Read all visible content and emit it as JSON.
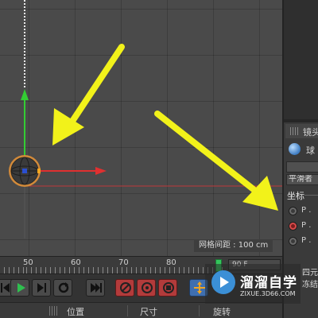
{
  "viewport": {
    "grid_spacing_text": "网格间距 : 100 cm"
  },
  "attribute_panel": {
    "tab_label": "镜头",
    "object_label": "球",
    "field_1": "",
    "field_2": "平滑者",
    "coord_header": "坐标",
    "radios": [
      {
        "label": "P .",
        "selected": false
      },
      {
        "label": "P .",
        "selected": true
      },
      {
        "label": "P .",
        "selected": false
      }
    ],
    "bottom_row_1": "四元",
    "bottom_row_2": "冻结"
  },
  "timeline": {
    "tick_labels": [
      "50",
      "60",
      "70",
      "80"
    ],
    "frame_field": "90 F"
  },
  "transport": {
    "buttons": [
      {
        "name": "go-to-previous-key-button",
        "icon": "prev-key-icon"
      },
      {
        "name": "play-forward-button",
        "icon": "play-icon"
      },
      {
        "name": "next-frame-button",
        "icon": "next-frame-icon"
      },
      {
        "name": "loop-button",
        "icon": "loop-icon"
      },
      {
        "name": "go-to-end-button",
        "icon": "go-to-end-icon"
      },
      {
        "name": "record-position-button",
        "icon": "record-icon"
      },
      {
        "name": "record-rotation-button",
        "icon": "record-rotation-icon"
      },
      {
        "name": "record-scale-button",
        "icon": "record-scale-icon"
      },
      {
        "name": "move-tool-button",
        "icon": "move-icon"
      }
    ]
  },
  "bottom_tabs": {
    "position": "位置",
    "size": "尺寸",
    "rotation": "旋转"
  },
  "watermark": {
    "title": "溜溜自学",
    "url": "ZIXUE.3D66.COM"
  },
  "colors": {
    "arrow_yellow": "#f2f21a",
    "axis_x": "#e03030",
    "axis_y": "#33cc33",
    "selected_radio": "#d94a4a",
    "timeline_marker": "#33c55b"
  }
}
